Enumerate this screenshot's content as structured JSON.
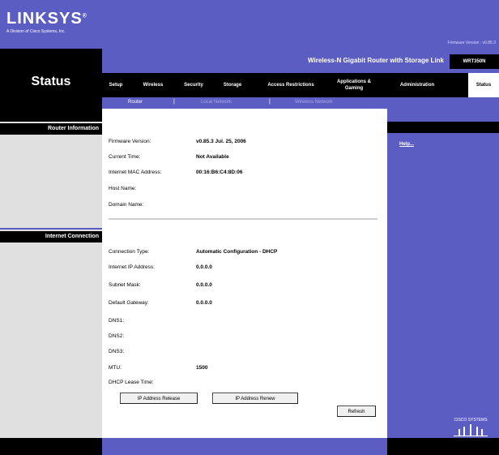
{
  "header": {
    "logo": "LINKSYS",
    "logo_reg": "®",
    "logo_sub": "A Division of Cisco Systems, Inc.",
    "firmware_top": "Firmware Version : v0.85.3"
  },
  "page_title": "Status",
  "product_name": "Wireless-N Gigabit Router with Storage Link",
  "model": "WRT350N",
  "tabs": [
    {
      "label": "Setup"
    },
    {
      "label": "Wireless"
    },
    {
      "label": "Security"
    },
    {
      "label": "Storage"
    },
    {
      "label": "Access Restrictions"
    },
    {
      "label": "Applications & Gaming"
    },
    {
      "label": "Administration"
    },
    {
      "label": "Status"
    }
  ],
  "subtabs": [
    {
      "label": "Router"
    },
    {
      "label": "Local Network"
    },
    {
      "label": "Wireless Network"
    }
  ],
  "sections": {
    "router_info": "Router Information",
    "internet_connection": "Internet Connection"
  },
  "router_info": [
    {
      "label": "Firmware Version:",
      "value": "v0.85.3 Jul. 25, 2006"
    },
    {
      "label": "Current Time:",
      "value": "Not Available"
    },
    {
      "label": "Internet MAC Address:",
      "value": "00:16:B6:C4:8D:06"
    },
    {
      "label": "Host Name:",
      "value": ""
    },
    {
      "label": "Domain Name:",
      "value": ""
    }
  ],
  "internet": [
    {
      "label": "Connection Type:",
      "value": "Automatic Configuration - DHCP"
    },
    {
      "label": "Internet IP Address:",
      "value": "0.0.0.0"
    },
    {
      "label": "Subnet Mask:",
      "value": "0.0.0.0"
    },
    {
      "label": "Default Gateway:",
      "value": "0.0.0.0"
    },
    {
      "label": "DNS1:",
      "value": ""
    },
    {
      "label": "DNS2:",
      "value": ""
    },
    {
      "label": "DNS3:",
      "value": ""
    },
    {
      "label": "MTU:",
      "value": "1500"
    },
    {
      "label": "DHCP Lease Time:",
      "value": ""
    }
  ],
  "buttons": {
    "release": "IP Address Release",
    "renew": "IP Address Renew",
    "refresh": "Refresh"
  },
  "help": "Help...",
  "cisco": "CISCO SYSTEMS",
  "colors": {
    "brand_purple": "#5c5dc2",
    "black": "#000000",
    "side_gray": "#e0e0e0"
  }
}
